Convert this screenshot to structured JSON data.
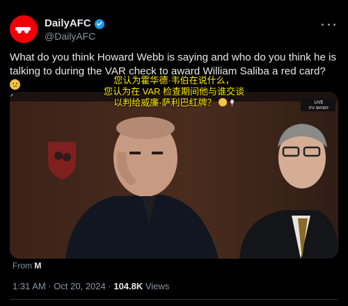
{
  "account": {
    "display_name": "DailyAFC",
    "handle": "@DailyAFC"
  },
  "tweet": {
    "text": "What do you think Howard Webb is saying and who do you think he is talking to during the VAR check to award William Saliba a red card?"
  },
  "caption": {
    "line1": "您认为霍华德·韦伯在说什么，",
    "line2": "您认为在 VAR 检查期间他与谁交谈",
    "line3": "以判给威廉·萨利巴红牌？"
  },
  "media": {
    "overlay_label": "LIVE",
    "network": "ITV SPORT"
  },
  "attribution": {
    "prefix": "From",
    "source": "M"
  },
  "meta": {
    "time": "1:31 AM",
    "separator": "·",
    "date": "Oct 20, 2024",
    "views_count": "104.8K",
    "views_label": "Views"
  },
  "colors": {
    "background": "#000000",
    "text": "#e7e9ea",
    "muted": "#8b98a5",
    "verified": "#1d9bf0",
    "caption": "#ffea00",
    "brand": "#ef0107"
  },
  "icons": {
    "verified": "verified-badge-icon",
    "more": "more-options-icon",
    "thinking_emoji": "thinking-face-emoji",
    "microphone": "microphone-emoji"
  }
}
